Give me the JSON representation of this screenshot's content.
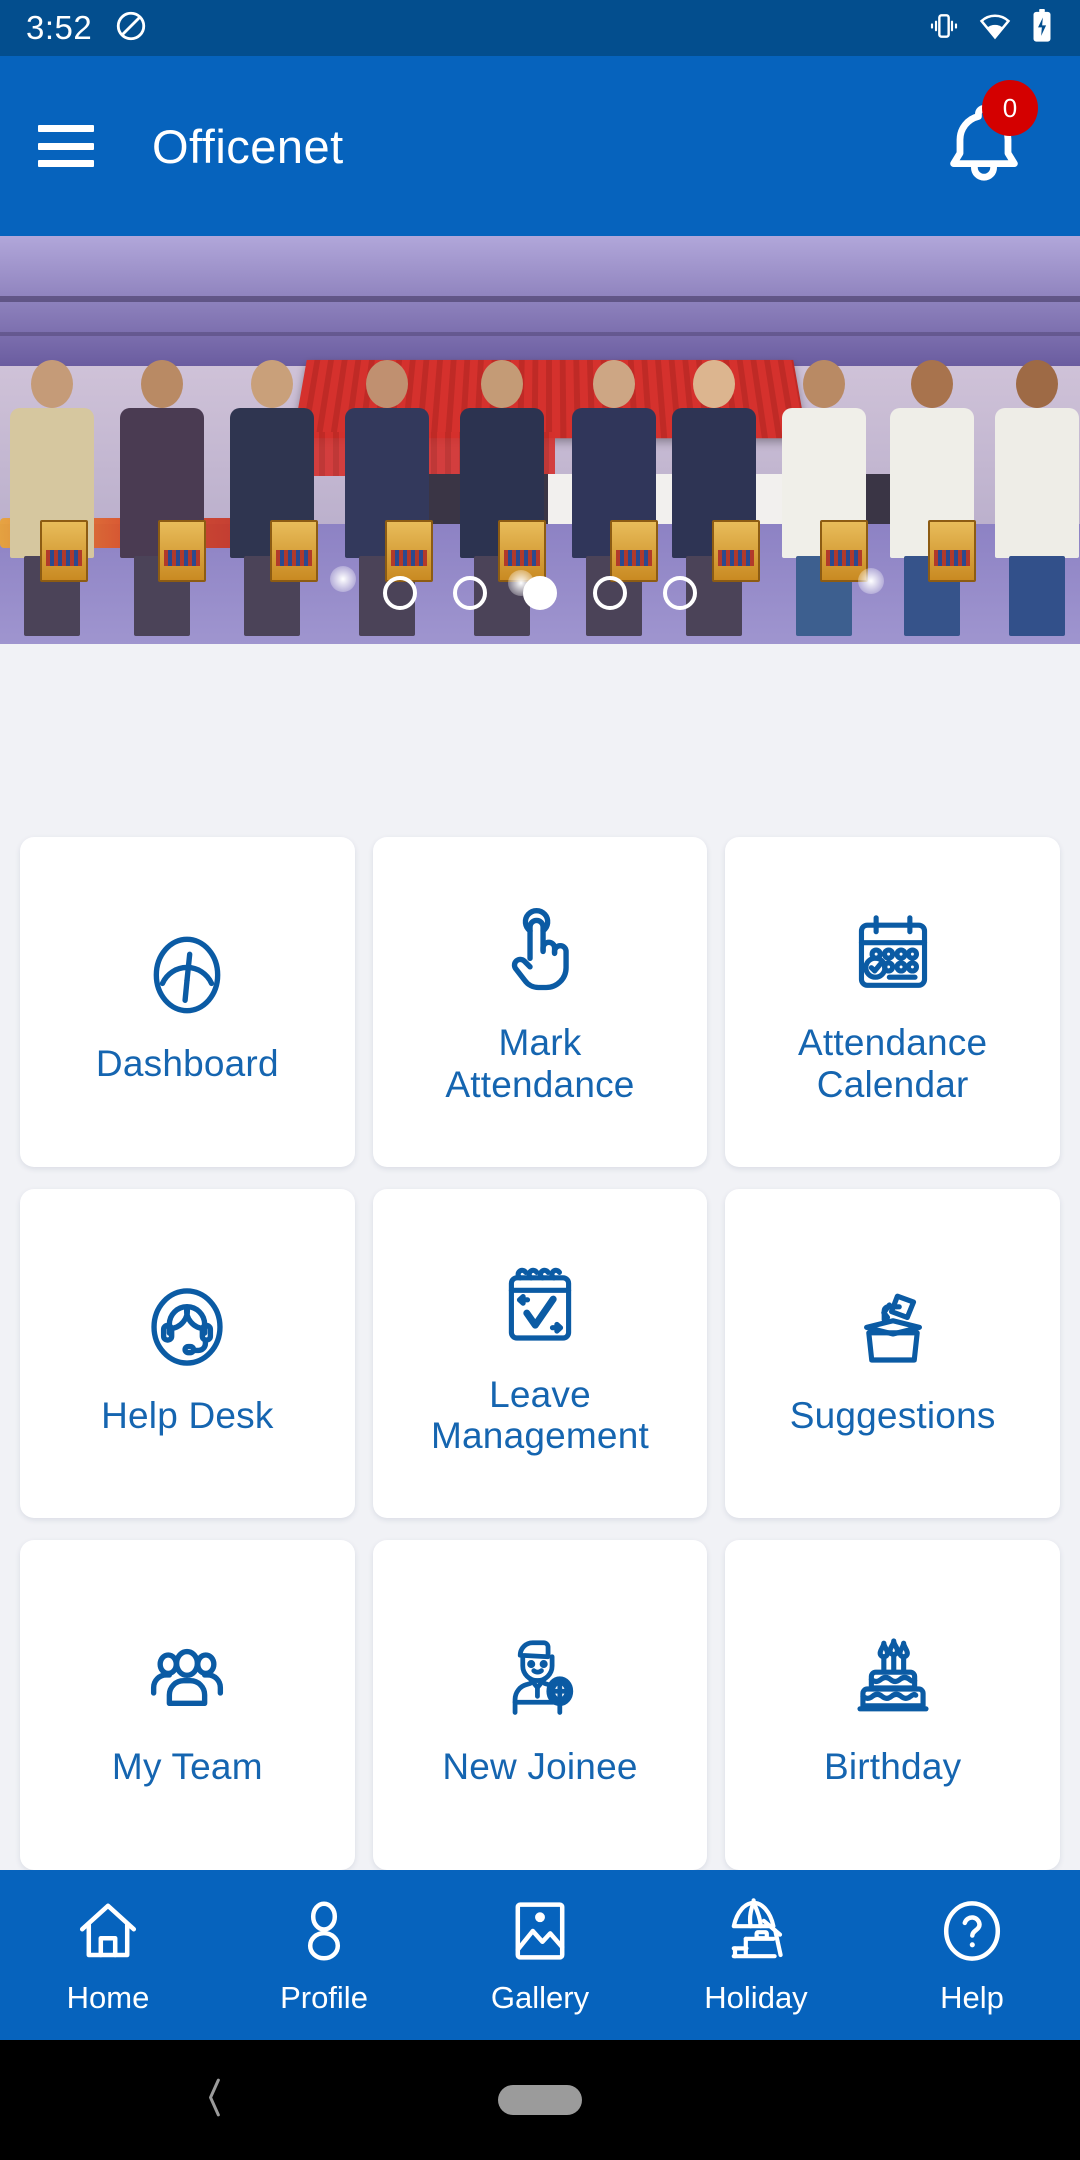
{
  "status_bar": {
    "time": "3:52",
    "icons": [
      "do-not-disturb-icon",
      "vibrate-icon",
      "wifi-icon",
      "battery-charging-icon"
    ],
    "background_color": "#034E8E"
  },
  "header": {
    "title": "Officenet",
    "menu_icon": "hamburger-menu-icon",
    "notification_icon": "bell-icon",
    "notification_count": "0",
    "badge_color": "#D40000",
    "background_color": "#0663BD"
  },
  "carousel": {
    "slide_count": 5,
    "active_index": 2,
    "description": "Event photo of group of people on stage holding books"
  },
  "grid": {
    "background_color": "#F1F2F6",
    "label_color": "#1565B0",
    "tiles": [
      {
        "label": "Dashboard",
        "icon": "speedometer-icon"
      },
      {
        "label": "Mark\nAttendance",
        "icon": "pointing-hand-icon"
      },
      {
        "label": "Attendance\nCalendar",
        "icon": "calendar-check-icon"
      },
      {
        "label": "Help Desk",
        "icon": "headset-support-icon"
      },
      {
        "label": "Leave\nManagement",
        "icon": "notepad-check-icon"
      },
      {
        "label": "Suggestions",
        "icon": "suggestion-box-icon"
      },
      {
        "label": "My Team",
        "icon": "people-group-icon"
      },
      {
        "label": "New Joinee",
        "icon": "new-employee-icon"
      },
      {
        "label": "Birthday",
        "icon": "birthday-cake-icon"
      }
    ]
  },
  "bottom_nav": {
    "background_color": "#0663BD",
    "items": [
      {
        "label": "Home",
        "icon": "home-icon"
      },
      {
        "label": "Profile",
        "icon": "person-icon"
      },
      {
        "label": "Gallery",
        "icon": "image-icon"
      },
      {
        "label": "Holiday",
        "icon": "beach-umbrella-icon"
      },
      {
        "label": "Help",
        "icon": "question-circle-icon"
      }
    ]
  },
  "android_nav": {
    "back_icon": "back-chevron-icon",
    "home_pill": "home-pill-indicator"
  }
}
